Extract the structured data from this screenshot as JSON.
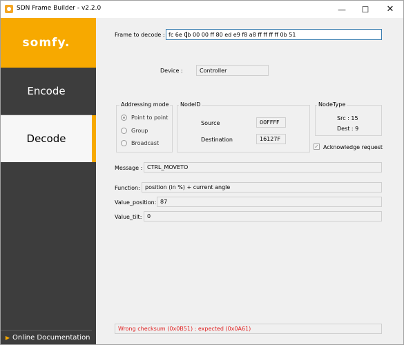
{
  "window": {
    "title": "SDN Frame Builder - v2.2.0",
    "minimize_glyph": "—",
    "maximize_glyph": "☐",
    "close_glyph": "✕"
  },
  "sidebar": {
    "logo": "somfy.",
    "items": [
      {
        "label": "Encode",
        "active": false
      },
      {
        "label": "Decode",
        "active": true
      }
    ],
    "doc_link": "Online Documentation",
    "accent_color": "#f7a900"
  },
  "frame": {
    "label": "Frame to decode :",
    "value_before_cursor": "fc 6e 0",
    "value_after_cursor": "b 00 00 ff 80 ed e9 f8 a8 ff ff ff ff 0b 51"
  },
  "device": {
    "label": "Device :",
    "value": "Controller"
  },
  "addressing": {
    "title": "Addressing mode",
    "options": [
      {
        "label": "Point to point",
        "checked": true
      },
      {
        "label": "Group",
        "checked": false
      },
      {
        "label": "Broadcast",
        "checked": false
      }
    ]
  },
  "nodeid": {
    "title": "NodeID",
    "source_label": "Source",
    "source_value": "00FFFF",
    "destination_label": "Destination",
    "destination_value": "16127F"
  },
  "nodetype": {
    "title": "NodeType",
    "src": "Src : 15",
    "dest": "Dest : 9"
  },
  "ack": {
    "label": "Acknowledge request",
    "checked": true
  },
  "message": {
    "label": "Message :",
    "value": "CTRL_MOVETO"
  },
  "function": {
    "label": "Function:",
    "value": "position (in %) + current angle"
  },
  "value_position": {
    "label": "Value_position:",
    "value": "87"
  },
  "value_tilt": {
    "label": "Value_tilt:",
    "value": "0"
  },
  "status": {
    "value": "Wrong checksum (0x0B51) : expected (0x0A61)",
    "color": "#e02020"
  }
}
